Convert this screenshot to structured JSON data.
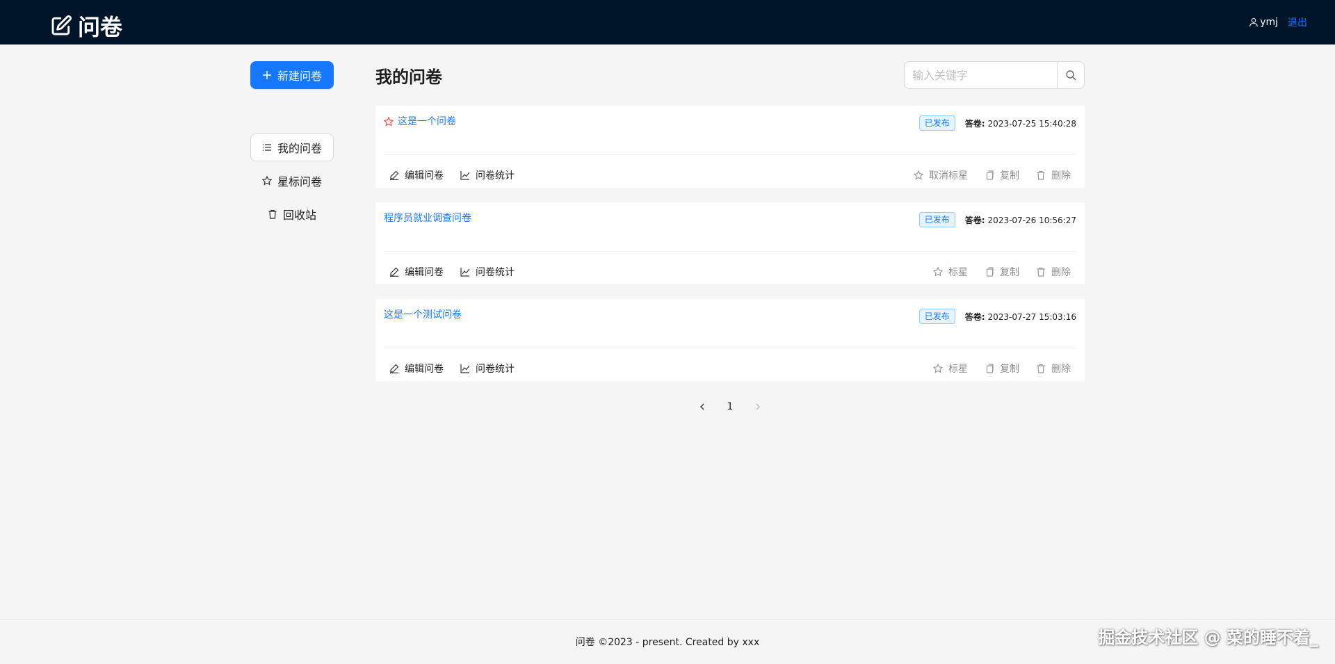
{
  "header": {
    "logo_text": "问卷",
    "user_name": "ymj",
    "logout_label": "退出"
  },
  "sidebar": {
    "create_label": "新建问卷",
    "items": [
      {
        "label": "我的问卷",
        "icon": "list-icon",
        "active": true
      },
      {
        "label": "星标问卷",
        "icon": "star-icon",
        "active": false
      },
      {
        "label": "回收站",
        "icon": "trash-icon",
        "active": false
      }
    ]
  },
  "main": {
    "title": "我的问卷",
    "search_placeholder": "输入关键字",
    "cards": [
      {
        "title": "这是一个问卷",
        "starred": true,
        "status": "已发布",
        "answer_label": "答卷:",
        "date": "2023-07-25 15:40:28",
        "edit": "编辑问卷",
        "stat": "问卷统计",
        "star_action": "取消标星",
        "copy": "复制",
        "delete": "删除"
      },
      {
        "title": "程序员就业调查问卷",
        "starred": false,
        "status": "已发布",
        "answer_label": "答卷:",
        "date": "2023-07-26 10:56:27",
        "edit": "编辑问卷",
        "stat": "问卷统计",
        "star_action": "标星",
        "copy": "复制",
        "delete": "删除"
      },
      {
        "title": "这是一个测试问卷",
        "starred": false,
        "status": "已发布",
        "answer_label": "答卷:",
        "date": "2023-07-27 15:03:16",
        "edit": "编辑问卷",
        "stat": "问卷统计",
        "star_action": "标星",
        "copy": "复制",
        "delete": "删除"
      }
    ],
    "pagination": {
      "current": "1"
    }
  },
  "footer": {
    "text": "问卷 ©2023 - present. Created by xxx"
  },
  "watermark": "掘金技术社区 @ 菜的睡不着_",
  "colors": {
    "header_bg": "#001529",
    "primary": "#1677ff",
    "star_red": "#ff4d4f"
  }
}
